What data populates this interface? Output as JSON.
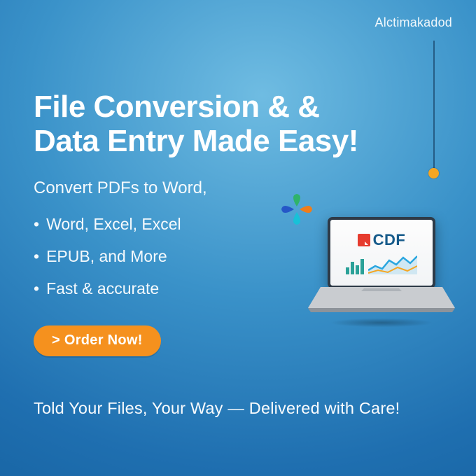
{
  "brand": "Alctimakadod",
  "hero": {
    "title_line1": "File Conversion & &",
    "title_line2": "Data Entry Made Easy!",
    "subhead": "Convert PDFs to Word,",
    "bullets": [
      "Word, Excel, Excel",
      "EPUB, and More",
      "Fast & accurate"
    ]
  },
  "cta": {
    "label": "> Order Now!"
  },
  "tagline": "Told Your Files, Your Way — Delivered with Care!",
  "laptop": {
    "logo_text": "CDF"
  }
}
